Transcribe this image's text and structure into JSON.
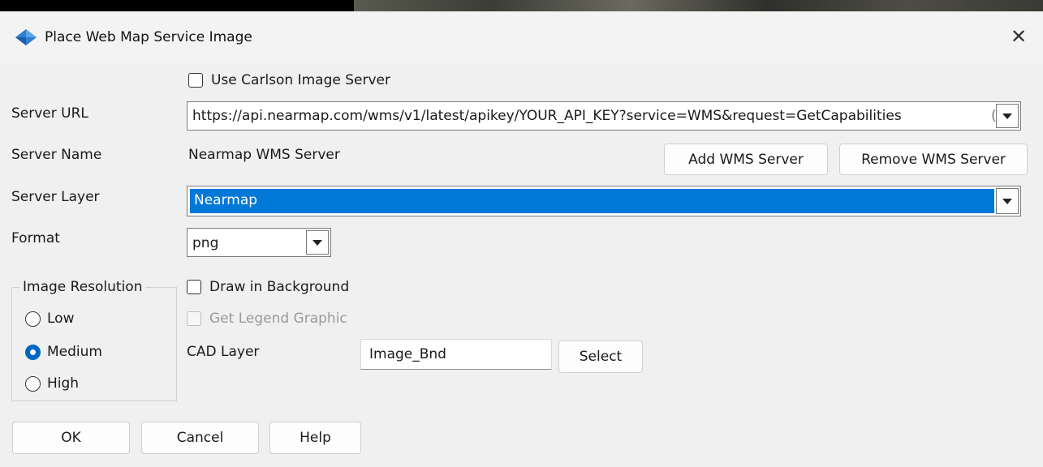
{
  "window": {
    "title": "Place Web Map Service Image",
    "close_glyph": "✕",
    "app_icon": "carlson-diamond-icon"
  },
  "server": {
    "use_carlson_label": "Use Carlson Image Server",
    "use_carlson_checked": false,
    "url_label": "Server URL",
    "url_value": "https://api.nearmap.com/wms/v1/latest/apikey/YOUR_API_KEY?service=WMS&request=GetCapabilities",
    "url_overflow": "(",
    "name_label": "Server Name",
    "name_value": "Nearmap WMS Server",
    "add_button": "Add WMS Server",
    "remove_button": "Remove WMS Server",
    "layer_label": "Server Layer",
    "layer_value": "Nearmap",
    "format_label": "Format",
    "format_value": "png"
  },
  "resolution": {
    "group_title": "Image Resolution",
    "options": [
      "Low",
      "Medium",
      "High"
    ],
    "selected": "Medium"
  },
  "options": {
    "draw_background_label": "Draw in Background",
    "draw_background_checked": false,
    "legend_label": "Get Legend Graphic",
    "legend_enabled": false
  },
  "cad": {
    "layer_label": "CAD Layer",
    "layer_value": "Image_Bnd",
    "select_button": "Select"
  },
  "footer": {
    "ok": "OK",
    "cancel": "Cancel",
    "help": "Help"
  },
  "colors": {
    "selection": "#0078d7",
    "radio_accent": "#0067c0",
    "dialog_bg": "#f0f0f0"
  }
}
